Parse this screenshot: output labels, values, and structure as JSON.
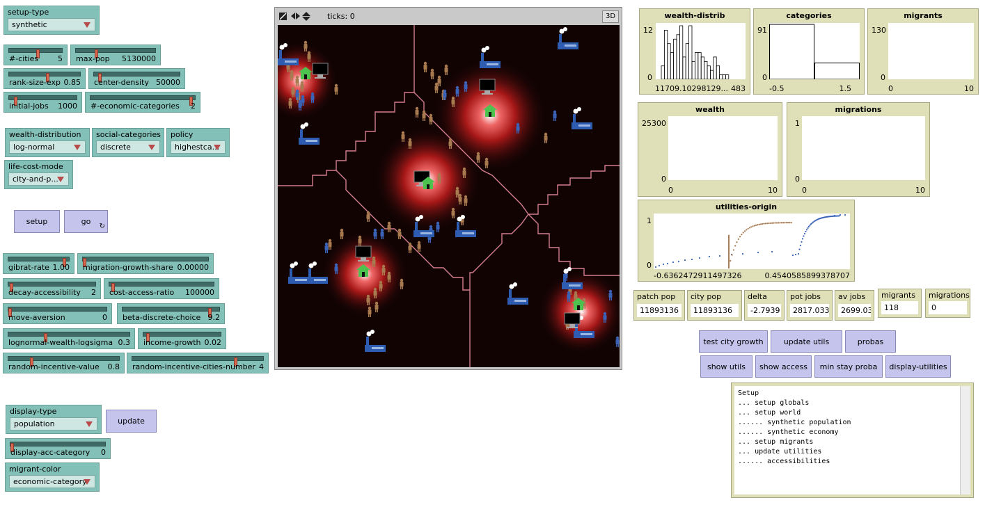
{
  "choosers": {
    "setup_type": {
      "label": "setup-type",
      "value": "synthetic"
    },
    "wealth_distribution": {
      "label": "wealth-distribution",
      "value": "log-normal"
    },
    "social_categories": {
      "label": "social-categories",
      "value": "discrete"
    },
    "policy": {
      "label": "policy",
      "value": "highestca..."
    },
    "life_cost_mode": {
      "label": "life-cost-mode",
      "value": "city-and-p..."
    },
    "display_type": {
      "label": "display-type",
      "value": "population"
    },
    "migrant_color": {
      "label": "migrant-color",
      "value": "economic-category"
    }
  },
  "sliders": {
    "n_cities": {
      "label": "#-cities",
      "value": "5",
      "fraction": 0.55
    },
    "max_pop": {
      "label": "max-pop",
      "value": "5130000",
      "fraction": 0.25
    },
    "rank_size_exp": {
      "label": "rank-size-exp",
      "value": "0.85",
      "fraction": 0.55
    },
    "center_density": {
      "label": "center-density",
      "value": "50000",
      "fraction": 0.05
    },
    "initial_jobs": {
      "label": "initial-jobs",
      "value": "1000",
      "fraction": 0.08
    },
    "n_economic_categories": {
      "label": "#-economic-categories",
      "value": "2",
      "fraction": 0.98
    },
    "gibrat_rate": {
      "label": "gibrat-rate",
      "value": "1.00",
      "fraction": 0.95
    },
    "migration_growth_share": {
      "label": "migration-growth-share",
      "value": "0.00000",
      "fraction": 0.0
    },
    "decay_accessibility": {
      "label": "decay-accessibility",
      "value": "2",
      "fraction": 0.02
    },
    "cost_access_ratio": {
      "label": "cost-access-ratio",
      "value": "100000",
      "fraction": 0.02
    },
    "move_aversion": {
      "label": "move-aversion",
      "value": "0",
      "fraction": 0.0
    },
    "beta_discrete_choice": {
      "label": "beta-discrete-choice",
      "value": "9.2",
      "fraction": 0.92
    },
    "lognormal_wealth_logsigma": {
      "label": "lognormal-wealth-logsigma",
      "value": "0.3",
      "fraction": 0.3
    },
    "income_growth": {
      "label": "income-growth",
      "value": "0.02",
      "fraction": 0.04
    },
    "random_incentive_value": {
      "label": "random-incentive-value",
      "value": "0.8",
      "fraction": 0.2
    },
    "random_incentive_cities_number": {
      "label": "random-incentive-cities-number",
      "value": "4",
      "fraction": 0.8
    },
    "display_acc_category": {
      "label": "display-acc-category",
      "value": "0",
      "fraction": 0.0
    }
  },
  "buttons": {
    "setup": "setup",
    "go": "go",
    "update": "update",
    "test_city_growth": "test city growth",
    "update_utils": "update utils",
    "probas": "probas",
    "show_utils": "show utils",
    "show_access": "show access",
    "min_stay_proba": "min stay proba",
    "display_utilities": "display-utilities"
  },
  "view": {
    "ticks_label": "ticks: 0",
    "three_d": "3D"
  },
  "plots": {
    "wealth_distrib": {
      "title": "wealth-distrib",
      "ymax": "12",
      "ymin": "0",
      "xmin": "11709.10298129...",
      "xmax": "483",
      "histogram": [
        3,
        11,
        8,
        6,
        9,
        10,
        12,
        5,
        8,
        12,
        4,
        6,
        6,
        5,
        4,
        3,
        2,
        5,
        3,
        1,
        1,
        1
      ]
    },
    "categories": {
      "title": "categories",
      "ymax": "91",
      "ymin": "0",
      "xmin": "-0.5",
      "xmax": "1.5",
      "values": [
        91,
        27
      ]
    },
    "migrants": {
      "title": "migrants",
      "ymax": "130",
      "ymin": "0",
      "xmin": "0",
      "xmax": "10"
    },
    "wealth": {
      "title": "wealth",
      "ymax": "25300",
      "ymin": "0",
      "xmin": "0",
      "xmax": "10"
    },
    "migrations": {
      "title": "migrations",
      "ymax": "1",
      "ymin": "0",
      "xmin": "0",
      "xmax": "10"
    },
    "utilities_origin": {
      "title": "utilities-origin",
      "ymax": "1",
      "ymin": "0",
      "xmin": "-0.6362472911497326",
      "xmax": "0.4540585899378707"
    }
  },
  "monitors": {
    "patch_pop": {
      "label": "patch pop",
      "value": "11893136"
    },
    "city_pop": {
      "label": "city pop",
      "value": "11893136"
    },
    "delta": {
      "label": "delta",
      "value": "-2.7939"
    },
    "pot_jobs": {
      "label": "pot jobs",
      "value": "2817.033"
    },
    "av_jobs": {
      "label": "av jobs",
      "value": "2699.03"
    },
    "migrants": {
      "label": "migrants",
      "value": "118"
    },
    "migrations": {
      "label": "migrations",
      "value": "0"
    }
  },
  "output_text": "Setup\n... setup globals\n... setup world\n...... synthetic population\n...... synthetic economy\n... setup migrants\n... update utilities\n...... accessibilities",
  "colors": {
    "migrant_brown": "#a87a50",
    "migrant_blue": "#3a63b8",
    "border_pink": "#d47d8e",
    "factory_blue": "#2d5cb0"
  }
}
